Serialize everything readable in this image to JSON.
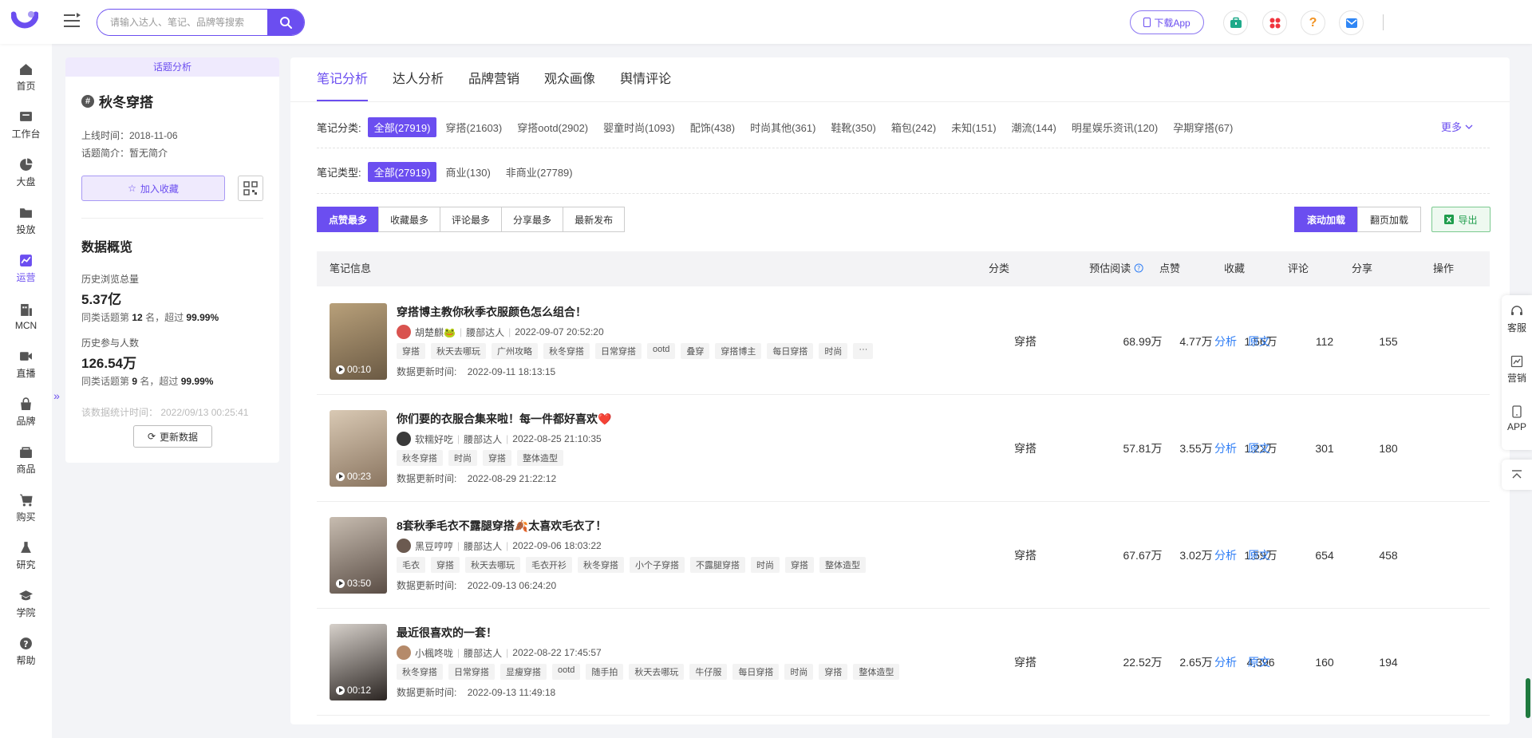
{
  "header": {
    "search_placeholder": "请输入达人、笔记、品牌等搜索",
    "download_label": "下载App",
    "icons": [
      "briefcase-icon",
      "apps-icon",
      "help-icon",
      "mail-icon"
    ]
  },
  "nav": {
    "items": [
      {
        "label": "首页",
        "icon": "home-icon"
      },
      {
        "label": "工作台",
        "icon": "workbench-icon"
      },
      {
        "label": "大盘",
        "icon": "pie-icon"
      },
      {
        "label": "投放",
        "icon": "folder-icon"
      },
      {
        "label": "运营",
        "icon": "chart-icon",
        "active": true
      },
      {
        "label": "MCN",
        "icon": "mcn-icon"
      },
      {
        "label": "直播",
        "icon": "video-icon"
      },
      {
        "label": "品牌",
        "icon": "bag-icon"
      },
      {
        "label": "商品",
        "icon": "shop-icon"
      },
      {
        "label": "购买",
        "icon": "cart-icon"
      },
      {
        "label": "研究",
        "icon": "flask-icon"
      },
      {
        "label": "学院",
        "icon": "graduation-icon"
      },
      {
        "label": "帮助",
        "icon": "help-icon"
      }
    ]
  },
  "topic": {
    "label": "话题分析",
    "title": "秋冬穿搭",
    "online_time": "上线时间：2018-11-06",
    "intro": "话题简介：暂无简介",
    "fav_label": "加入收藏",
    "overview_title": "数据概览",
    "history_views_label": "历史浏览总量",
    "history_views_value": "5.37亿",
    "history_views_rank_pre": "同类话题第",
    "history_views_rank": "12",
    "history_views_rank_mid": "名，超过",
    "history_views_pct": "99.99%",
    "participants_label": "历史参与人数",
    "participants_value": "126.54万",
    "participants_rank_pre": "同类话题第",
    "participants_rank": "9",
    "participants_rank_mid": "名，超过",
    "participants_pct": "99.99%",
    "stats_note": "该数据统计时间：  2022/09/13 00:25:41",
    "refresh_label": "更新数据"
  },
  "tabs": [
    {
      "label": "笔记分析",
      "active": true
    },
    {
      "label": "达人分析"
    },
    {
      "label": "品牌营销"
    },
    {
      "label": "观众画像"
    },
    {
      "label": "舆情评论"
    }
  ],
  "category_filter": {
    "label": "笔记分类:",
    "chips": [
      "全部(27919)",
      "穿搭(21603)",
      "穿搭ootd(2902)",
      "婴童时尚(1093)",
      "配饰(438)",
      "时尚其他(361)",
      "鞋靴(350)",
      "箱包(242)",
      "未知(151)",
      "潮流(144)",
      "明星娱乐资讯(120)",
      "孕期穿搭(67)"
    ],
    "more_label": "更多"
  },
  "type_filter": {
    "label": "笔记类型:",
    "chips": [
      "全部(27919)",
      "商业(130)",
      "非商业(27789)"
    ]
  },
  "sort_buttons": [
    "点赞最多",
    "收藏最多",
    "评论最多",
    "分享最多",
    "最新发布"
  ],
  "load_buttons": [
    "滚动加载",
    "翻页加载"
  ],
  "export_label": "导出",
  "table": {
    "headers": {
      "info": "笔记信息",
      "category": "分类",
      "reads": "预估阅读",
      "likes": "点赞",
      "collects": "收藏",
      "comments": "评论",
      "shares": "分享",
      "ops": "操作"
    },
    "update_label": "数据更新时间:",
    "op_analyze": "分析",
    "op_source": "原文",
    "rows": [
      {
        "title": "穿搭博主教你秋季衣服颜色怎么组合！",
        "author": "胡楚麒🐸",
        "role": "腰部达人",
        "published": "2022-09-07 20:52:20",
        "tags": [
          "穿搭",
          "秋天去哪玩",
          "广州攻略",
          "秋冬穿搭",
          "日常穿搭",
          "ootd",
          "叠穿",
          "穿搭博主",
          "每日穿搭",
          "时尚",
          "···"
        ],
        "updated": "2022-09-11 18:13:15",
        "duration": "00:10",
        "category": "穿搭",
        "reads": "68.99万",
        "likes": "4.77万",
        "collects": "1.56万",
        "comments": "112",
        "shares": "155",
        "thumb_colors": [
          "#6b5a44",
          "#b8a07a"
        ],
        "avatar_color": "#d9534f"
      },
      {
        "title": "你们要的衣服合集来啦！每一件都好喜欢❤️",
        "author": "软糯好吃",
        "role": "腰部达人",
        "published": "2022-08-25 21:10:35",
        "tags": [
          "秋冬穿搭",
          "时尚",
          "穿搭",
          "整体造型"
        ],
        "updated": "2022-08-29 21:22:12",
        "duration": "00:23",
        "category": "穿搭",
        "reads": "57.81万",
        "likes": "3.55万",
        "collects": "1.22万",
        "comments": "301",
        "shares": "180",
        "thumb_colors": [
          "#8a7560",
          "#d9c9b4"
        ],
        "avatar_color": "#3a3a3a"
      },
      {
        "title": "8套秋季毛衣不露腿穿搭🍂太喜欢毛衣了！",
        "author": "黑豆哼哼",
        "role": "腰部达人",
        "published": "2022-09-06 18:03:22",
        "tags": [
          "毛衣",
          "穿搭",
          "秋天去哪玩",
          "毛衣开衫",
          "秋冬穿搭",
          "小个子穿搭",
          "不露腿穿搭",
          "时尚",
          "穿搭",
          "整体造型"
        ],
        "updated": "2022-09-13 06:24:20",
        "duration": "03:50",
        "category": "穿搭",
        "reads": "67.67万",
        "likes": "3.02万",
        "collects": "1.59万",
        "comments": "654",
        "shares": "458",
        "thumb_colors": [
          "#5a4d45",
          "#c7bcb0"
        ],
        "avatar_color": "#6b5a50"
      },
      {
        "title": "最近很喜欢的一套！",
        "author": "小楓咚咙",
        "role": "腰部达人",
        "published": "2022-08-22 17:45:57",
        "tags": [
          "秋冬穿搭",
          "日常穿搭",
          "显瘦穿搭",
          "ootd",
          "随手拍",
          "秋天去哪玩",
          "牛仔服",
          "每日穿搭",
          "时尚",
          "穿搭",
          "整体造型"
        ],
        "updated": "2022-09-13 11:49:18",
        "duration": "00:12",
        "category": "穿搭",
        "reads": "22.52万",
        "likes": "2.65万",
        "collects": "4,396",
        "comments": "160",
        "shares": "194",
        "thumb_colors": [
          "#2b2522",
          "#d6d0ca"
        ],
        "avatar_color": "#b58a6a"
      }
    ]
  },
  "float_bar": [
    "客服",
    "营销",
    "APP"
  ],
  "colors": {
    "accent": "#6b4ef0",
    "link": "#2f7ef5",
    "export_green": "#1f9d4c"
  }
}
